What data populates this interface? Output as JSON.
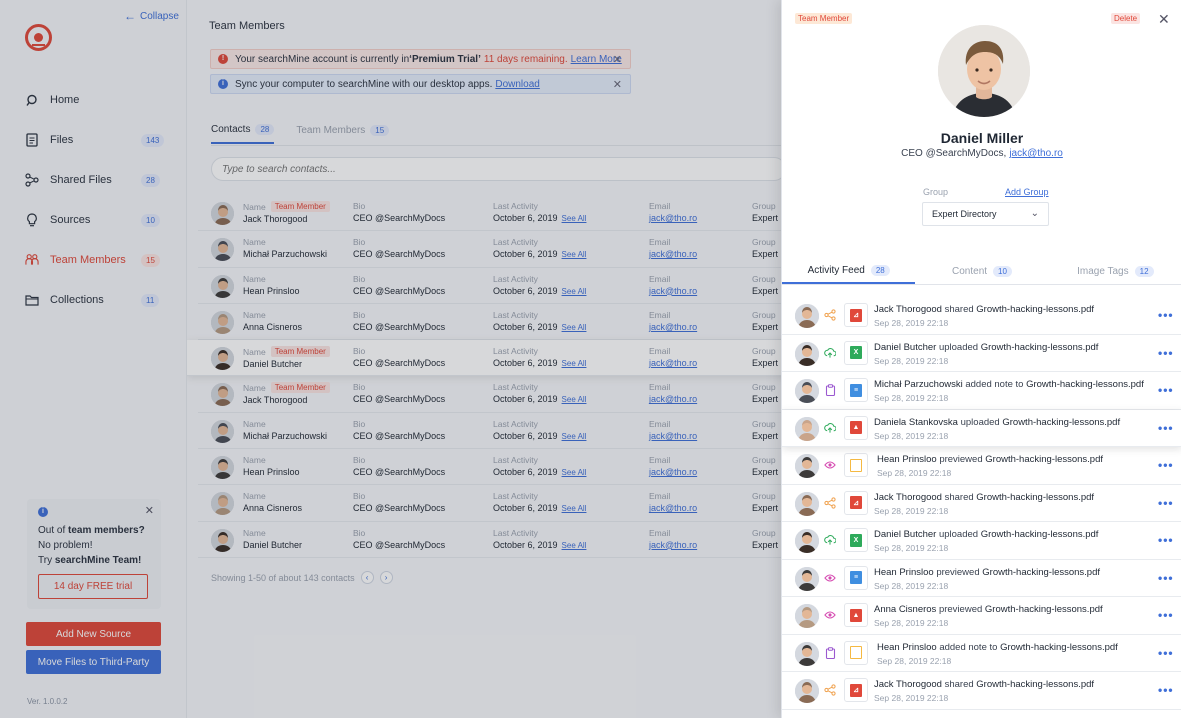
{
  "app": {
    "collapse_label": "Collapse",
    "version": "Ver. 1.0.0.2",
    "colors": {
      "accent": "#e0483a",
      "link": "#3f6fd8"
    }
  },
  "sidebar": {
    "items": [
      {
        "label": "Home",
        "badge": "",
        "icon": "search-icon"
      },
      {
        "label": "Files",
        "badge": "143",
        "icon": "file-icon"
      },
      {
        "label": "Shared Files",
        "badge": "28",
        "icon": "share-icon"
      },
      {
        "label": "Sources",
        "badge": "10",
        "icon": "bulb-icon"
      },
      {
        "label": "Team Members",
        "badge": "15",
        "icon": "team-icon"
      },
      {
        "label": "Collections",
        "badge": "11",
        "icon": "folder-icon"
      }
    ],
    "promo": {
      "line1_pre": "Out of ",
      "line1_bold": "team members?",
      "line2": "No problem!",
      "line3_pre": "Try ",
      "line3_bold": "searchMine Team!",
      "trial_label": "14 day FREE trial"
    },
    "add_source_label": "Add New Source",
    "move_files_label": "Move Files to Third-Party"
  },
  "main": {
    "title": "Team Members",
    "banner_warn": {
      "pre": "Your searchMine account is currently in ",
      "plan": "‘Premium Trial’",
      "remaining": "11 days remaining.",
      "link": "Learn More"
    },
    "banner_info": {
      "text": "Sync your computer to searchMine with our desktop apps.",
      "link": "Download"
    },
    "tabs": [
      {
        "label": "Contacts",
        "count": "28"
      },
      {
        "label": "Team Members",
        "count": "15"
      }
    ],
    "search_placeholder": "Type to search contacts...",
    "columns": {
      "name": "Name",
      "bio": "Bio",
      "activity": "Last Activity",
      "email": "Email",
      "group": "Group"
    },
    "see_all": "See All",
    "team_member_badge": "Team Member",
    "rows": [
      {
        "name": "Jack Thorogood",
        "member": true,
        "bio": "CEO @SearchMyDocs",
        "activity": "October 6, 2019",
        "email": "jack@tho.ro",
        "group": "Expert",
        "avatar": "#8a6b55"
      },
      {
        "name": "Michał Parzuchowski",
        "member": false,
        "bio": "CEO @SearchMyDocs",
        "activity": "October 6, 2019",
        "email": "jack@tho.ro",
        "group": "Expert",
        "avatar": "#4a4e57"
      },
      {
        "name": "Hean Prinsloo",
        "member": false,
        "bio": "CEO @SearchMyDocs",
        "activity": "October 6, 2019",
        "email": "jack@tho.ro",
        "group": "Expert",
        "avatar": "#3d3b3a"
      },
      {
        "name": "Anna Cisneros",
        "member": false,
        "bio": "CEO @SearchMyDocs",
        "activity": "October 6, 2019",
        "email": "jack@tho.ro",
        "group": "Expert",
        "avatar": "#b59a82"
      },
      {
        "name": "Daniel Butcher",
        "member": true,
        "bio": "CEO @SearchMyDocs",
        "activity": "October 6, 2019",
        "email": "jack@tho.ro",
        "group": "Expert",
        "avatar": "#3a2e27"
      },
      {
        "name": "Jack Thorogood",
        "member": true,
        "bio": "CEO @SearchMyDocs",
        "activity": "October 6, 2019",
        "email": "jack@tho.ro",
        "group": "Expert",
        "avatar": "#8a6b55"
      },
      {
        "name": "Michał Parzuchowski",
        "member": false,
        "bio": "CEO @SearchMyDocs",
        "activity": "October 6, 2019",
        "email": "jack@tho.ro",
        "group": "Expert",
        "avatar": "#4a4e57"
      },
      {
        "name": "Hean Prinsloo",
        "member": false,
        "bio": "CEO @SearchMyDocs",
        "activity": "October 6, 2019",
        "email": "jack@tho.ro",
        "group": "Expert",
        "avatar": "#3d3b3a"
      },
      {
        "name": "Anna Cisneros",
        "member": false,
        "bio": "CEO @SearchMyDocs",
        "activity": "October 6, 2019",
        "email": "jack@tho.ro",
        "group": "Expert",
        "avatar": "#b59a82"
      },
      {
        "name": "Daniel Butcher",
        "member": false,
        "bio": "CEO @SearchMyDocs",
        "activity": "October 6, 2019",
        "email": "jack@tho.ro",
        "group": "Expert",
        "avatar": "#3a2e27"
      }
    ],
    "pager_text": "Showing 1-50 of about 143 contacts"
  },
  "panel": {
    "role_badge": "Team Member",
    "delete_label": "Delete",
    "name": "Daniel Miller",
    "role": "CEO @SearchMyDocs,",
    "email": "jack@tho.ro",
    "group_label": "Group",
    "add_group_label": "Add Group",
    "group_value": "Expert Directory",
    "tabs": [
      {
        "label": "Activity Feed",
        "count": "28"
      },
      {
        "label": "Content",
        "count": "10"
      },
      {
        "label": "Image Tags",
        "count": "12"
      }
    ],
    "feed": [
      {
        "who": "Jack Thorogood",
        "verb": "shared",
        "file": "Growth-hacking-lessons.pdf",
        "date": "Sep 28, 2019 22:18",
        "action": "share",
        "type": "pdf",
        "avatar": "#8a6b55"
      },
      {
        "who": "Daniel Butcher",
        "verb": "uploaded",
        "file": "Growth-hacking-lessons.pdf",
        "date": "Sep 28, 2019 22:18",
        "action": "upload",
        "type": "xls",
        "avatar": "#3a2e27"
      },
      {
        "who": "Michał Parzuchowski",
        "verb": "added note to",
        "file": "Growth-hacking-lessons.pdf",
        "date": "Sep 28, 2019 22:18",
        "action": "note",
        "type": "doc",
        "avatar": "#4a4e57"
      },
      {
        "who": "Daniela Stankovska",
        "verb": "uploaded",
        "file": "Growth-hacking-lessons.pdf",
        "date": "Sep 28, 2019 22:18",
        "action": "upload",
        "type": "img",
        "avatar": "#c9a48a"
      },
      {
        "who": "Hean Prinsloo",
        "verb": "previewed",
        "file": "Growth-hacking-lessons.pdf",
        "date": "Sep 28, 2019 22:18",
        "action": "view",
        "type": "blank",
        "avatar": "#3d3b3a"
      },
      {
        "who": "Jack Thorogood",
        "verb": "shared",
        "file": "Growth-hacking-lessons.pdf",
        "date": "Sep 28, 2019 22:18",
        "action": "share",
        "type": "pdf",
        "avatar": "#8a6b55"
      },
      {
        "who": "Daniel Butcher",
        "verb": "uploaded",
        "file": "Growth-hacking-lessons.pdf",
        "date": "Sep 28, 2019 22:18",
        "action": "upload",
        "type": "xls",
        "avatar": "#3a2e27"
      },
      {
        "who": "Hean Prinsloo",
        "verb": "previewed",
        "file": "Growth-hacking-lessons.pdf",
        "date": "Sep 28, 2019 22:18",
        "action": "view",
        "type": "doc",
        "avatar": "#3d3b3a"
      },
      {
        "who": "Anna Cisneros",
        "verb": "previewed",
        "file": "Growth-hacking-lessons.pdf",
        "date": "Sep 28, 2019 22:18",
        "action": "view",
        "type": "img",
        "avatar": "#b59a82"
      },
      {
        "who": "Hean Prinsloo",
        "verb": "added note to",
        "file": "Growth-hacking-lessons.pdf",
        "date": "Sep 28, 2019 22:18",
        "action": "note",
        "type": "blank",
        "avatar": "#3d3b3a"
      },
      {
        "who": "Jack Thorogood",
        "verb": "shared",
        "file": "Growth-hacking-lessons.pdf",
        "date": "Sep 28, 2019 22:18",
        "action": "share",
        "type": "pdf",
        "avatar": "#8a6b55"
      }
    ]
  }
}
